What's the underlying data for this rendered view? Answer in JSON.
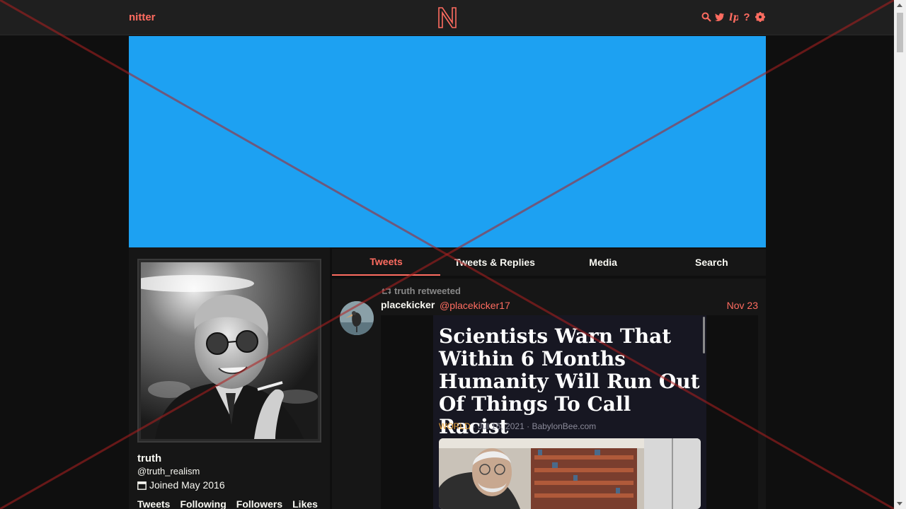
{
  "nav": {
    "brand": "nitter",
    "logo_letter": "N",
    "icons": [
      "search-icon",
      "twitter-bird-icon",
      "rss-icon",
      "help-icon",
      "gear-icon"
    ]
  },
  "colors": {
    "accent": "#ff6c60",
    "banner": "#1da1f2",
    "background": "#0f0f0f",
    "panel": "#161616"
  },
  "profile": {
    "name": "truth",
    "handle": "@truth_realism",
    "joined": "Joined May 2016",
    "stats": [
      "Tweets",
      "Following",
      "Followers",
      "Likes"
    ]
  },
  "tabs": [
    {
      "label": "Tweets",
      "active": true
    },
    {
      "label": "Tweets & Replies",
      "active": false
    },
    {
      "label": "Media",
      "active": false
    },
    {
      "label": "Search",
      "active": false
    }
  ],
  "tweet": {
    "retweeted_by": "truth retweeted",
    "author": "placekicker",
    "handle": "@placekicker17",
    "date": "Nov 23",
    "article": {
      "title": "Scientists Warn That Within 6 Months Humanity Will Run Out Of Things To Call Racist",
      "category": "WORLD",
      "date": "Jul 16, 2021",
      "source": "BabylonBee.com"
    }
  }
}
